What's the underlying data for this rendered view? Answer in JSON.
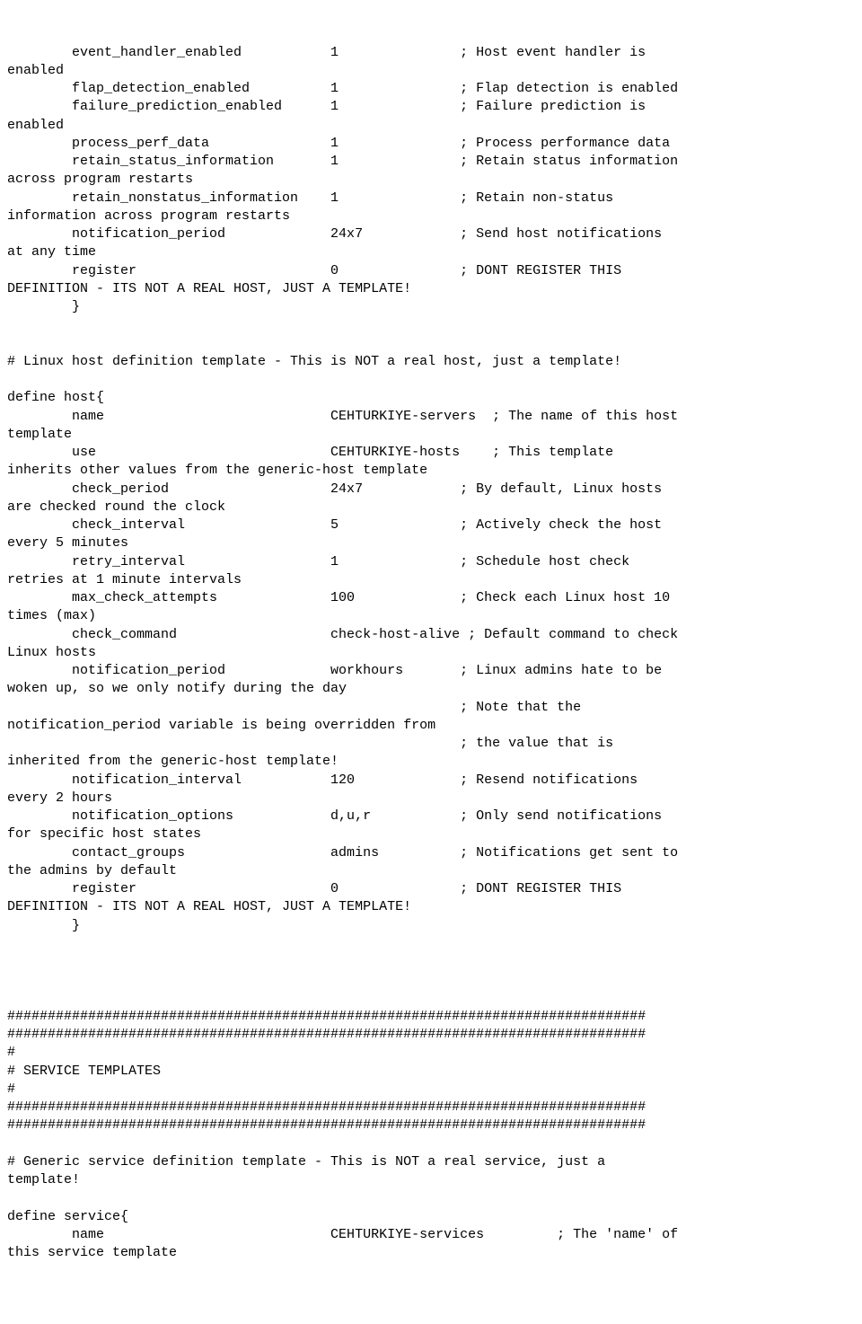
{
  "text": "        event_handler_enabled           1               ; Host event handler is\nenabled\n        flap_detection_enabled          1               ; Flap detection is enabled\n        failure_prediction_enabled      1               ; Failure prediction is\nenabled\n        process_perf_data               1               ; Process performance data\n        retain_status_information       1               ; Retain status information\nacross program restarts\n        retain_nonstatus_information    1               ; Retain non-status\ninformation across program restarts\n        notification_period             24x7            ; Send host notifications\nat any time\n        register                        0               ; DONT REGISTER THIS\nDEFINITION - ITS NOT A REAL HOST, JUST A TEMPLATE!\n        }\n\n\n# Linux host definition template - This is NOT a real host, just a template!\n\ndefine host{\n        name                            CEHTURKIYE-servers  ; The name of this host\ntemplate\n        use                             CEHTURKIYE-hosts    ; This template\ninherits other values from the generic-host template\n        check_period                    24x7            ; By default, Linux hosts\nare checked round the clock\n        check_interval                  5               ; Actively check the host\nevery 5 minutes\n        retry_interval                  1               ; Schedule host check\nretries at 1 minute intervals\n        max_check_attempts              100             ; Check each Linux host 10\ntimes (max)\n        check_command                   check-host-alive ; Default command to check\nLinux hosts\n        notification_period             workhours       ; Linux admins hate to be\nwoken up, so we only notify during the day\n                                                        ; Note that the\nnotification_period variable is being overridden from\n                                                        ; the value that is\ninherited from the generic-host template!\n        notification_interval           120             ; Resend notifications\nevery 2 hours\n        notification_options            d,u,r           ; Only send notifications\nfor specific host states\n        contact_groups                  admins          ; Notifications get sent to\nthe admins by default\n        register                        0               ; DONT REGISTER THIS\nDEFINITION - ITS NOT A REAL HOST, JUST A TEMPLATE!\n        }\n\n\n\n\n###############################################################################\n###############################################################################\n#\n# SERVICE TEMPLATES\n#\n###############################################################################\n###############################################################################\n\n# Generic service definition template - This is NOT a real service, just a\ntemplate!\n\ndefine service{\n        name                            CEHTURKIYE-services         ; The 'name' of\nthis service template"
}
